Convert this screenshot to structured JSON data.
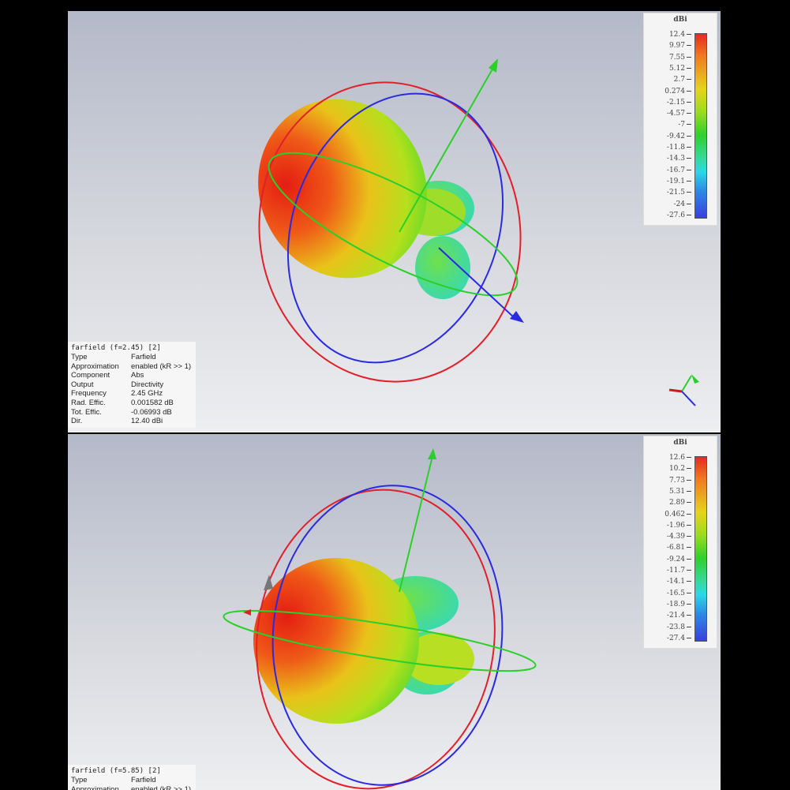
{
  "panels": [
    {
      "colorbar": {
        "unit": "dBi",
        "ticks": [
          "12.4",
          "9.97",
          "7.55",
          "5.12",
          "2.7",
          "0.274",
          "-2.15",
          "-4.57",
          "-7",
          "-9.42",
          "-11.8",
          "-14.3",
          "-16.7",
          "-19.1",
          "-21.5",
          "-24",
          "-27.6"
        ]
      },
      "info": {
        "title": "farfield (f=2.45) [2]",
        "rows": [
          [
            "Type",
            "Farfield"
          ],
          [
            "Approximation",
            "enabled (kR >> 1)"
          ],
          [
            "Component",
            "Abs"
          ],
          [
            "Output",
            "Directivity"
          ],
          [
            "Frequency",
            "2.45 GHz"
          ],
          [
            "Rad. Effic.",
            "0.001582 dB"
          ],
          [
            "Tot. Effic.",
            "-0.06993 dB"
          ],
          [
            "Dir.",
            "12.40 dBi"
          ]
        ]
      }
    },
    {
      "colorbar": {
        "unit": "dBi",
        "ticks": [
          "12.6",
          "10.2",
          "7.73",
          "5.31",
          "2.89",
          "0.462",
          "-1.96",
          "-4.39",
          "-6.81",
          "-9.24",
          "-11.7",
          "-14.1",
          "-16.5",
          "-18.9",
          "-21.4",
          "-23.8",
          "-27.4"
        ]
      },
      "info": {
        "title": "farfield (f=5.85) [2]",
        "rows": [
          [
            "Type",
            "Farfield"
          ],
          [
            "Approximation",
            "enabled (kR >> 1)"
          ]
        ]
      }
    }
  ]
}
